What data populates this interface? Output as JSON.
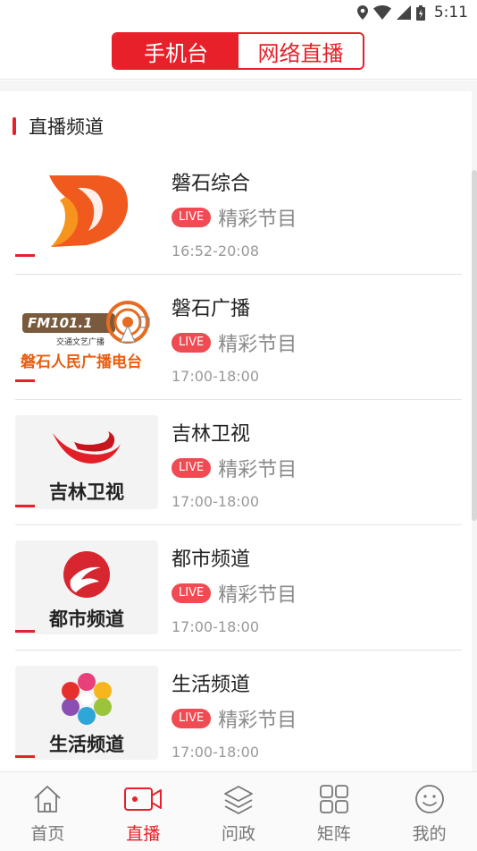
{
  "status_bar": {
    "time": "5:11",
    "icons": [
      "location-icon",
      "wifi-icon",
      "signal-icon",
      "battery-icon"
    ]
  },
  "top_switch": {
    "tabs": [
      {
        "label": "手机台",
        "active": true
      },
      {
        "label": "网络直播",
        "active": false
      }
    ]
  },
  "section": {
    "title": "直播频道"
  },
  "channels": [
    {
      "name": "磐石综合",
      "badge": "LIVE",
      "program": "精彩节目",
      "time": "16:52-20:08",
      "logo": "panshi-logo"
    },
    {
      "name": "磐石广播",
      "badge": "LIVE",
      "program": "精彩节目",
      "time": "17:00-18:00",
      "logo": "fm-radio-logo",
      "logo_text": {
        "top": "FM101.1",
        "sub": "交通文艺广播",
        "bottom": "磐石人民广播电台"
      }
    },
    {
      "name": "吉林卫视",
      "badge": "LIVE",
      "program": "精彩节目",
      "time": "17:00-18:00",
      "logo": "jilin-tv-logo",
      "logo_text": {
        "bottom": "吉林卫视"
      }
    },
    {
      "name": "都市频道",
      "badge": "LIVE",
      "program": "精彩节目",
      "time": "17:00-18:00",
      "logo": "city-channel-logo",
      "logo_text": {
        "bottom": "都市频道"
      }
    },
    {
      "name": "生活频道",
      "badge": "LIVE",
      "program": "精彩节目",
      "time": "17:00-18:00",
      "logo": "life-channel-logo",
      "logo_text": {
        "bottom": "生活频道"
      }
    }
  ],
  "bottom_nav": [
    {
      "label": "首页",
      "icon": "home-icon",
      "active": false
    },
    {
      "label": "直播",
      "icon": "video-camera-icon",
      "active": true
    },
    {
      "label": "问政",
      "icon": "layers-icon",
      "active": false
    },
    {
      "label": "矩阵",
      "icon": "grid-icon",
      "active": false
    },
    {
      "label": "我的",
      "icon": "smiley-icon",
      "active": false
    }
  ],
  "colors": {
    "accent": "#e8202a",
    "live_badge": "#f04a52",
    "muted_text": "#8a8a8a"
  }
}
